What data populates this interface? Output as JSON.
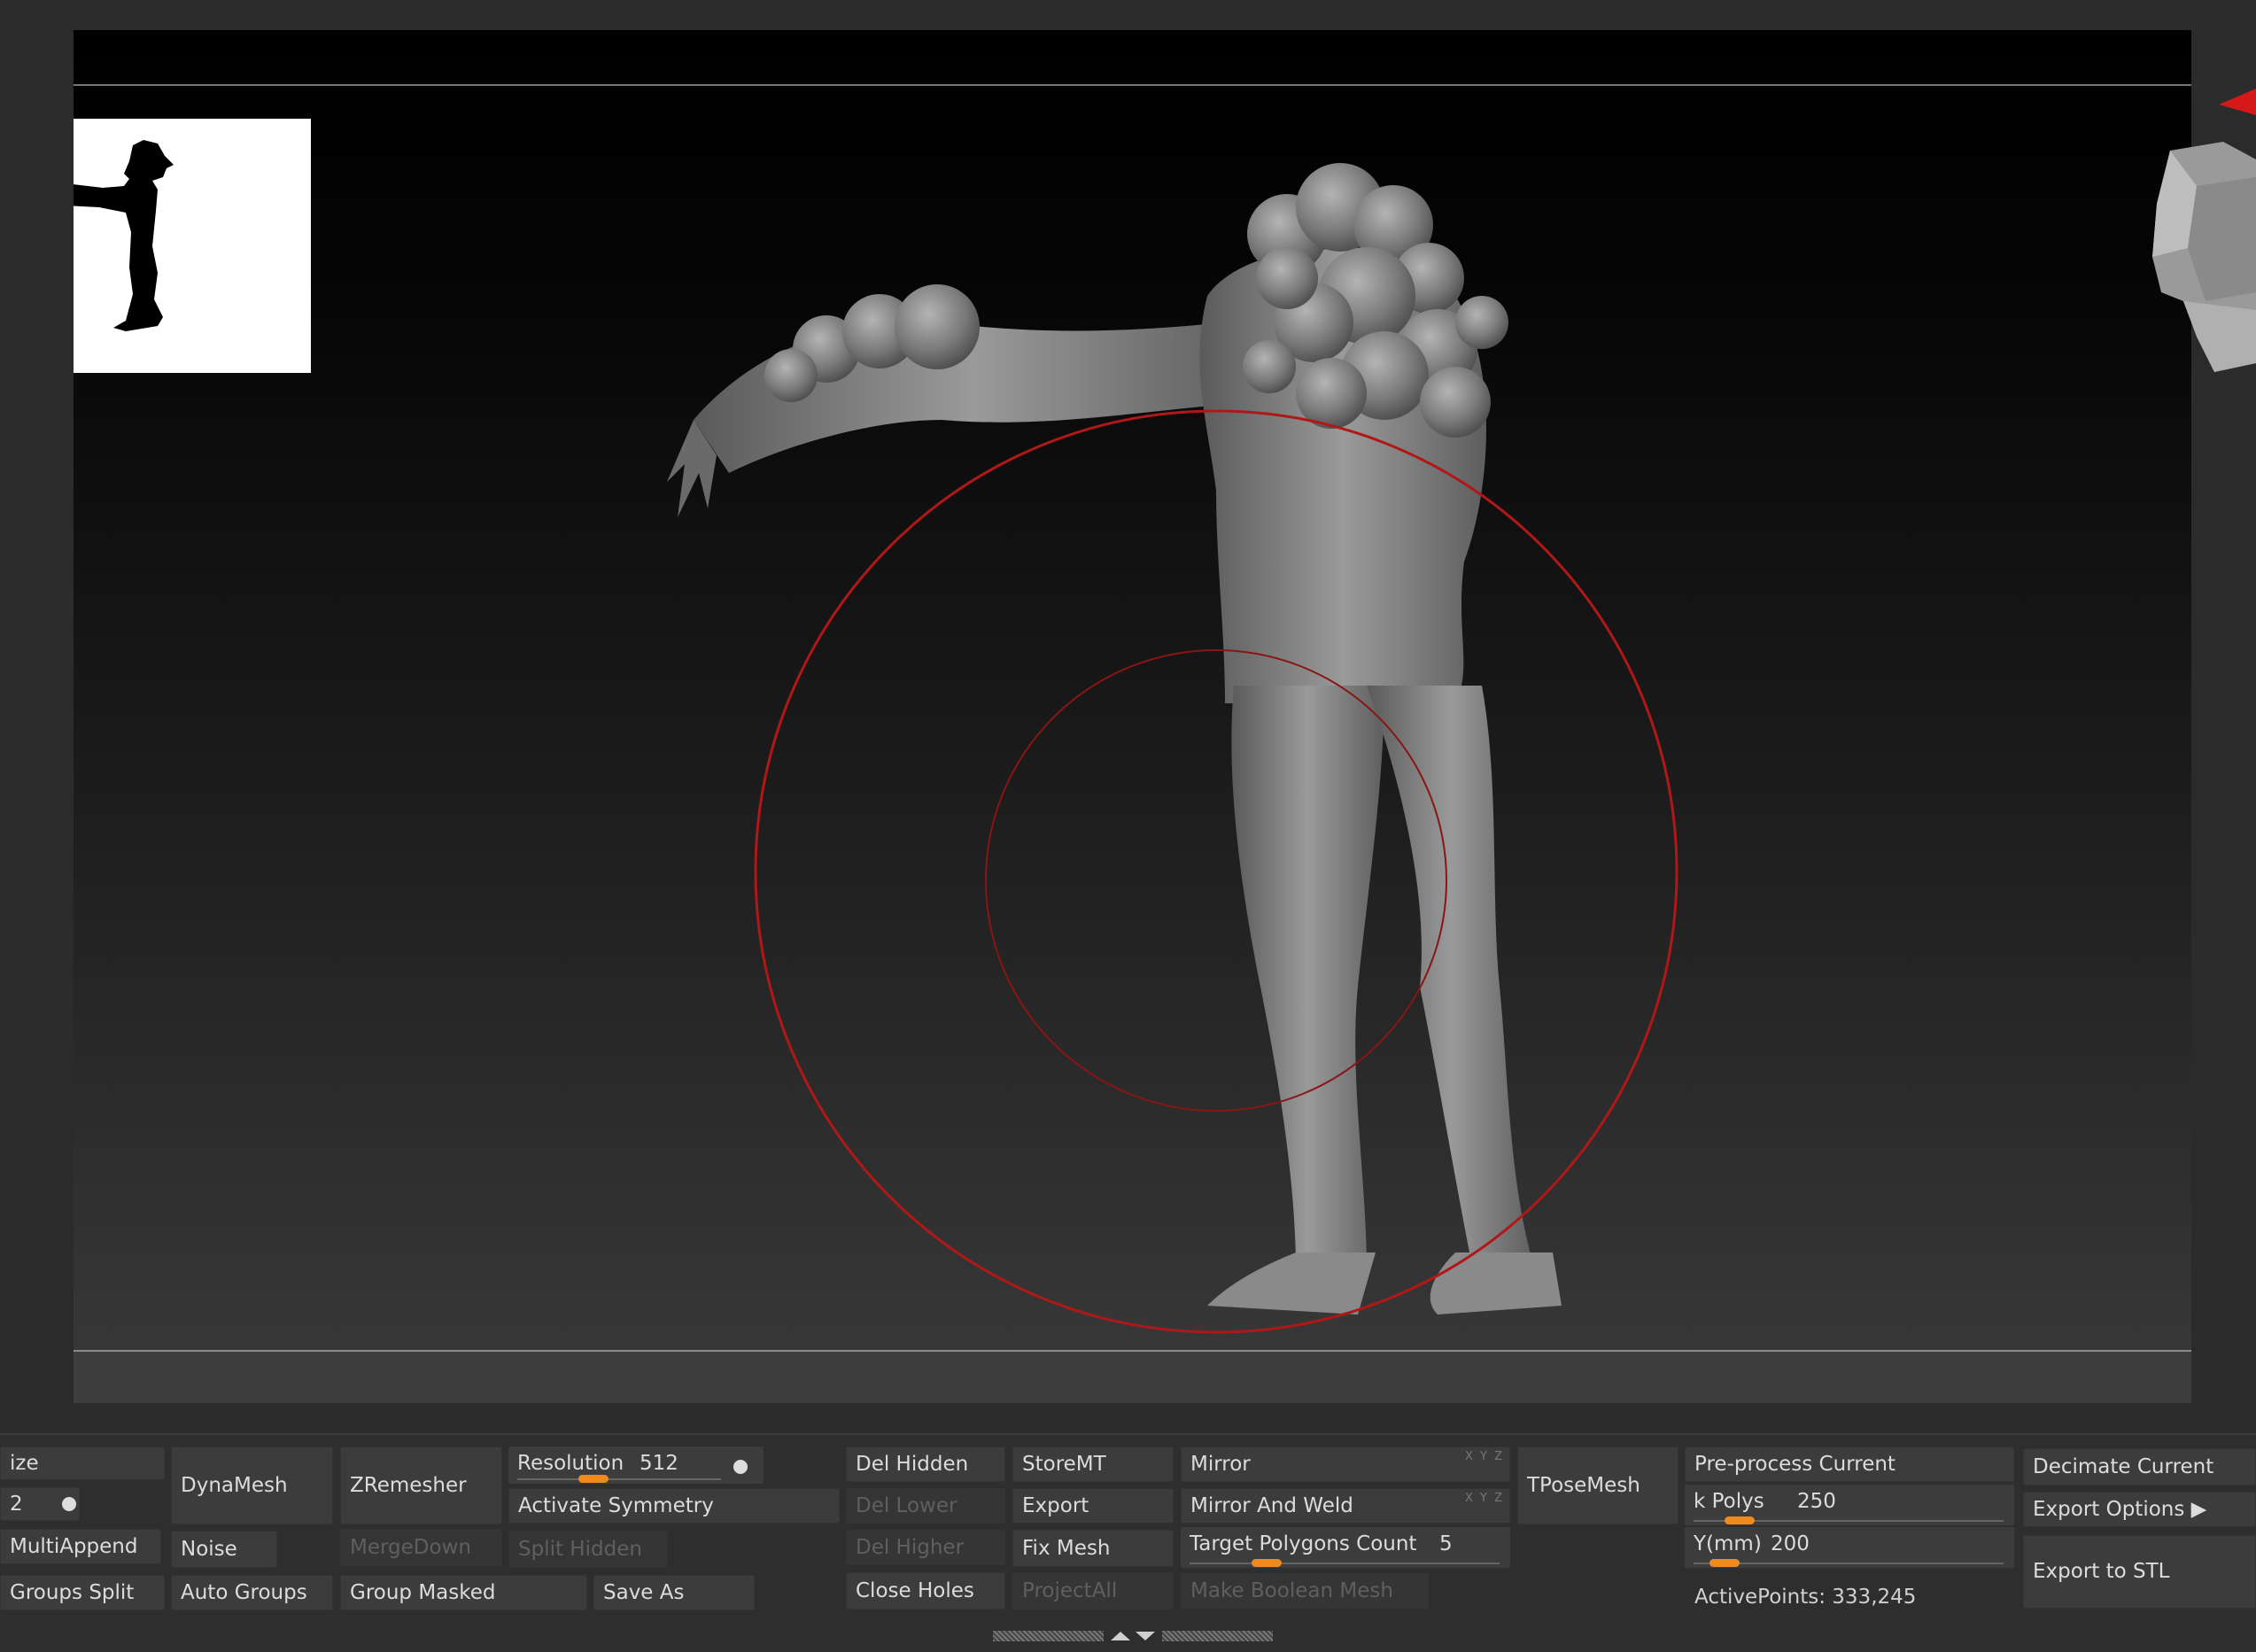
{
  "viewport": {
    "silhouette_label": "silhouette-thumbnail",
    "icons": [
      "navigation-head-icon",
      "red-arrow-icon",
      "brush-cursor-circle"
    ]
  },
  "panel": {
    "col1": {
      "size_label": "ize",
      "size_value": "2",
      "multiappend": "MultiAppend",
      "groups_split": "Groups Split"
    },
    "col2": {
      "dynamesh": "DynaMesh",
      "noise": "Noise",
      "auto_groups": "Auto Groups"
    },
    "col3": {
      "zremesher": "ZRemesher",
      "mergedown": "MergeDown",
      "group_masked": "Group Masked"
    },
    "col4": {
      "resolution_label": "Resolution",
      "resolution_value": "512",
      "resolution_fraction": 0.3,
      "activate_symmetry": "Activate Symmetry",
      "split_hidden": "Split Hidden",
      "save_as": "Save As"
    },
    "col5": {
      "del_hidden": "Del Hidden",
      "del_lower": "Del Lower",
      "del_higher": "Del Higher",
      "close_holes": "Close Holes"
    },
    "col6": {
      "storemt": "StoreMT",
      "export": "Export",
      "fix_mesh": "Fix Mesh",
      "projectall": "ProjectAll"
    },
    "col7": {
      "mirror": "Mirror",
      "mirror_and_weld": "Mirror And Weld",
      "target_polygons_label": "Target Polygons Count",
      "target_polygons_value": "5",
      "target_polygons_fraction": 0.2,
      "make_boolean_mesh": "Make Boolean Mesh",
      "xyz": "X Y Z"
    },
    "col8": {
      "tposemesh": "TPoseMesh"
    },
    "col9": {
      "preprocess": "Pre-process Current",
      "kpolys_label": "k Polys",
      "kpolys_value": "250",
      "kpolys_fraction": 0.1,
      "ymm_label": "Y(mm)",
      "ymm_value": "200",
      "ymm_fraction": 0.05,
      "active_points": "ActivePoints: 333,245"
    },
    "col10": {
      "decimate_current": "Decimate Current",
      "export_options": "Export Options ▶",
      "export_to_stl": "Export to STL"
    }
  }
}
